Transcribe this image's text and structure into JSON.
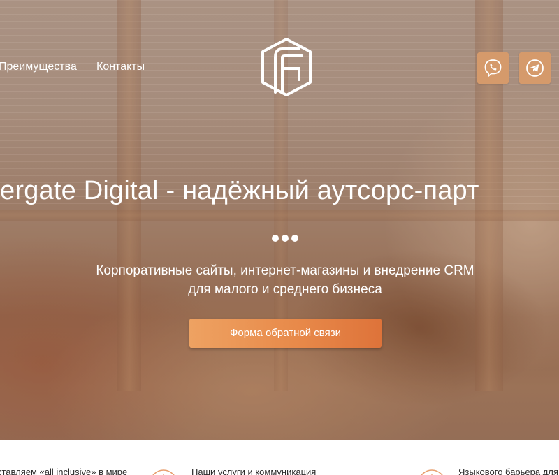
{
  "nav": {
    "advantages": "Преимущества",
    "contacts": "Контакты"
  },
  "logo": {
    "icon": "fg-hexagon-logo-icon"
  },
  "social": {
    "viber_icon": "viber-icon",
    "telegram_icon": "telegram-icon",
    "button_color": "#d59a6b"
  },
  "hero": {
    "title": "ergate Digital - надёжный аутсорс-парт",
    "subtitle_line1": "Корпоративные сайты, интернет-магазины и внедрение CRM",
    "subtitle_line2": "для малого и среднего бизнеса",
    "cta_label": "Форма обратной связи",
    "accent_color": "#e88a4a"
  },
  "features": [
    {
      "text": "ставляем «all inclusive» в мире"
    },
    {
      "text": "Наши услуги и коммуникация",
      "icon": "orange-circle-icon"
    },
    {
      "text": "Языкового барьера для",
      "icon": "orange-circle-icon"
    }
  ]
}
